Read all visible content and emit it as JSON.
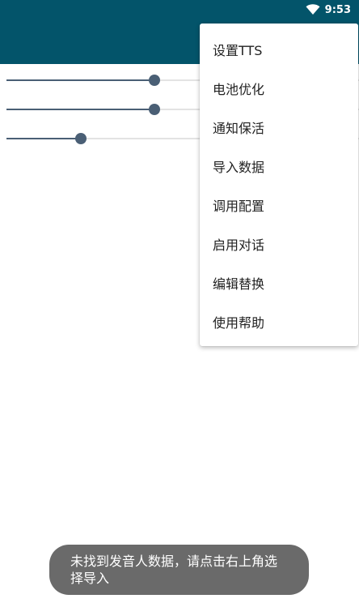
{
  "status_bar": {
    "time": "9:53",
    "wifi_icon": "wifi-icon"
  },
  "sliders": [
    {
      "name": "slider-1",
      "value": 0.42
    },
    {
      "name": "slider-2",
      "value": 0.42
    },
    {
      "name": "slider-3",
      "value": 0.21
    }
  ],
  "menu": {
    "items": [
      {
        "label": "设置TTS"
      },
      {
        "label": "电池优化"
      },
      {
        "label": "通知保活"
      },
      {
        "label": "导入数据"
      },
      {
        "label": "调用配置"
      },
      {
        "label": "启用对话"
      },
      {
        "label": "编辑替换"
      },
      {
        "label": "使用帮助"
      }
    ]
  },
  "toast": {
    "message": "未找到发音人数据，请点击右上角选择导入"
  },
  "colors": {
    "appbar": "#03546a",
    "accent": "#4a5f75",
    "toast_bg": "#6a6a6a"
  }
}
